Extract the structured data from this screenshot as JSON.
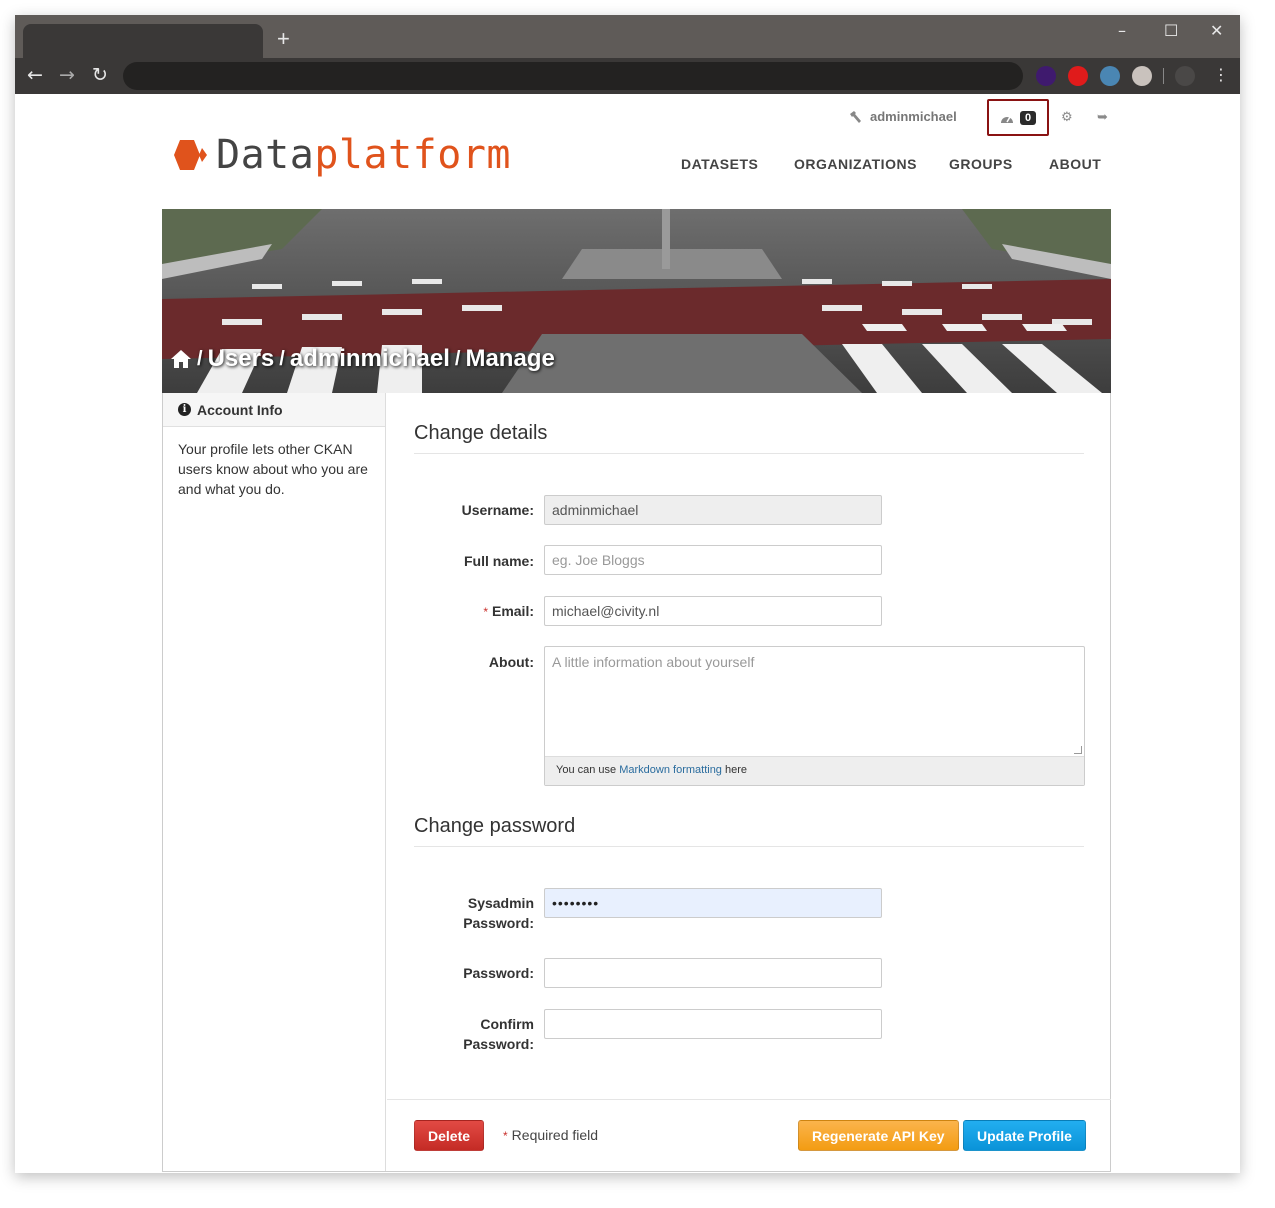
{
  "browser": {
    "new_tab_glyph": "+",
    "minimize_glyph": "–",
    "maximize_glyph": "☐",
    "close_glyph": "✕",
    "back_glyph": "←",
    "forward_glyph": "→",
    "reload_glyph": "↻",
    "menu_glyph": "⋮",
    "extension_colors": [
      "#3f1a6e",
      "#e01b1b",
      "#4a86b3",
      "#c9c2bd",
      "#4a4847"
    ]
  },
  "header": {
    "username": "adminmichael",
    "dashboard_count": "0",
    "user_icon": "hammer-icon",
    "dashboard_icon": "dashboard-icon",
    "settings_icon": "gear-icon",
    "logout_icon": "sign-out-icon"
  },
  "logo": {
    "part1": "Data",
    "part2": "platform",
    "brand_color": "#e0531c"
  },
  "nav": {
    "items": [
      "DATASETS",
      "ORGANIZATIONS",
      "GROUPS",
      "ABOUT"
    ]
  },
  "breadcrumb": {
    "sep": "/",
    "items": [
      "Users",
      "adminmichael",
      "Manage"
    ]
  },
  "sidebar": {
    "title": "Account Info",
    "text": "Your profile lets other CKAN users know about who you are and what you do."
  },
  "form": {
    "change_details_title": "Change details",
    "username_label": "Username:",
    "username_value": "adminmichael",
    "fullname_label": "Full name:",
    "fullname_placeholder": "eg. Joe Bloggs",
    "email_label": "Email:",
    "email_value": "michael@civity.nl",
    "required_mark": "*",
    "about_label": "About:",
    "about_placeholder": "A little information about yourself",
    "markdown_prefix": "You can use",
    "markdown_link": "Markdown formatting",
    "markdown_suffix": "here",
    "change_password_title": "Change password",
    "sysadmin_password_label_1": "Sysadmin",
    "sysadmin_password_label_2": "Password:",
    "sysadmin_password_value": "••••••••",
    "password_label": "Password:",
    "confirm_label_1": "Confirm",
    "confirm_label_2": "Password:"
  },
  "actions": {
    "delete": "Delete",
    "required_note": "Required field",
    "regenerate": "Regenerate API Key",
    "update": "Update Profile"
  }
}
